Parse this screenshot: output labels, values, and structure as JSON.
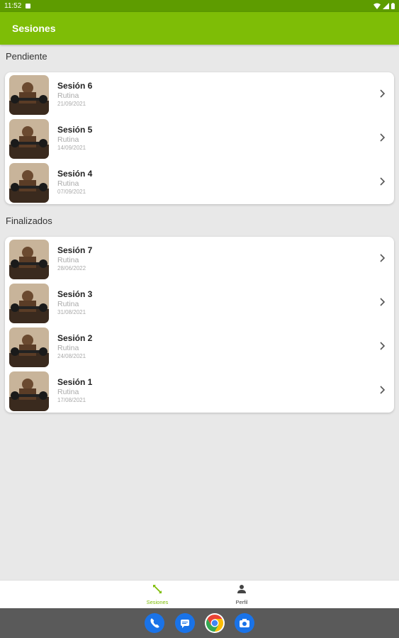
{
  "status_bar": {
    "time": "11:52"
  },
  "app_bar": {
    "title": "Sesiones"
  },
  "sections": [
    {
      "label": "Pendiente",
      "items": [
        {
          "title": "Sesión 6",
          "subtitle": "Rutina",
          "date": "21/09/2021"
        },
        {
          "title": "Sesión 5",
          "subtitle": "Rutina",
          "date": "14/09/2021"
        },
        {
          "title": "Sesión 4",
          "subtitle": "Rutina",
          "date": "07/09/2021"
        }
      ]
    },
    {
      "label": "Finalizados",
      "items": [
        {
          "title": "Sesión 7",
          "subtitle": "Rutina",
          "date": "28/06/2022"
        },
        {
          "title": "Sesión 3",
          "subtitle": "Rutina",
          "date": "31/08/2021"
        },
        {
          "title": "Sesión 2",
          "subtitle": "Rutina",
          "date": "24/08/2021"
        },
        {
          "title": "Sesión 1",
          "subtitle": "Rutina",
          "date": "17/08/2021"
        }
      ]
    }
  ],
  "bottom_nav": [
    {
      "label": "Sesiones",
      "icon": "arrows-expand-icon",
      "active": true
    },
    {
      "label": "Perfil",
      "icon": "person-icon",
      "active": false
    }
  ],
  "colors": {
    "accent": "#7ebd06",
    "status_bar": "#5e9c00",
    "background": "#e8e8e8"
  },
  "dock_apps": [
    "phone-icon",
    "messages-icon",
    "chrome-icon",
    "camera-icon"
  ]
}
